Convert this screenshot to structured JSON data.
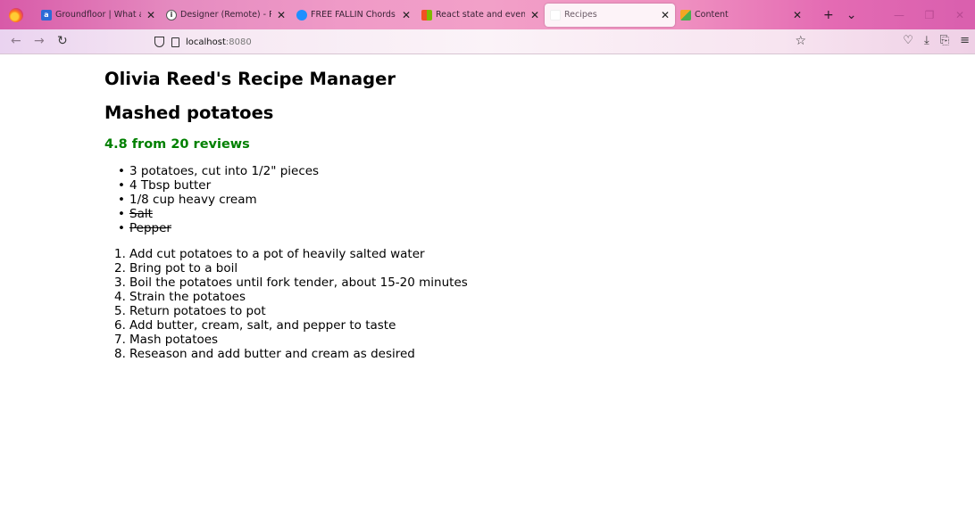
{
  "browser": {
    "tabs": [
      {
        "title": "Groundfloor | What are you",
        "favicon": "groundfloor",
        "favicon_color": "#2d6bd6",
        "favicon_text": "a",
        "active": false
      },
      {
        "title": "Designer (Remote) - Raleig",
        "favicon": "info-icon",
        "favicon_color": "#ffffff",
        "favicon_text": "i",
        "active": false
      },
      {
        "title": "FREE FALLIN Chords - Tom",
        "favicon": "chords",
        "favicon_color": "#1f8fff",
        "favicon_text": "",
        "active": false
      },
      {
        "title": "React state and events - Tra",
        "favicon": "microsoft",
        "favicon_color": "#f25022",
        "favicon_text": "",
        "active": false
      },
      {
        "title": "Recipes",
        "favicon": "blank",
        "favicon_color": "#ffffff",
        "favicon_text": "",
        "active": true
      },
      {
        "title": "Content",
        "favicon": "content",
        "favicon_color": "#f5a623",
        "favicon_text": "",
        "active": false
      }
    ],
    "url": {
      "host": "localhost",
      "port": ":8080"
    }
  },
  "page": {
    "app_title": "Olivia Reed's Recipe Manager",
    "recipe_name": "Mashed potatoes",
    "rating_text": "4.8 from 20 reviews",
    "rating_color": "#008000",
    "ingredients": [
      {
        "text": "3 potatoes, cut into 1/2\" pieces",
        "struck": false
      },
      {
        "text": "4 Tbsp butter",
        "struck": false
      },
      {
        "text": "1/8 cup heavy cream",
        "struck": false
      },
      {
        "text": "Salt",
        "struck": true
      },
      {
        "text": "Pepper",
        "struck": true
      }
    ],
    "steps": [
      "Add cut potatoes to a pot of heavily salted water",
      "Bring pot to a boil",
      "Boil the potatoes until fork tender, about 15-20 minutes",
      "Strain the potatoes",
      "Return potatoes to pot",
      "Add butter, cream, salt, and pepper to taste",
      "Mash potatoes",
      "Reseason and add butter and cream as desired"
    ]
  }
}
